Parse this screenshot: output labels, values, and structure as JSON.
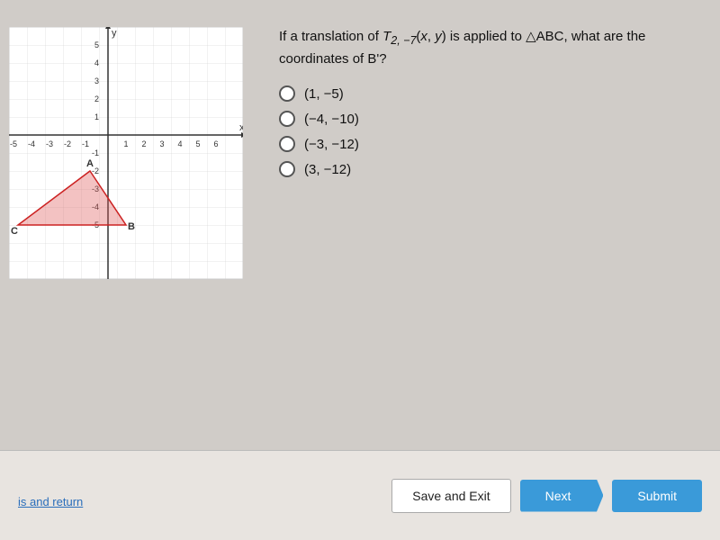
{
  "question": {
    "text_part1": "If a translation of ",
    "formula": "T",
    "subscript": "2, −7",
    "text_part2": "(x, y) is applied to △ABC, what are the coordinates of B'?",
    "options": [
      {
        "id": "opt1",
        "label": "(1, −5)"
      },
      {
        "id": "opt2",
        "label": "(−4, −10)"
      },
      {
        "id": "opt3",
        "label": "(−3, −12)"
      },
      {
        "id": "opt4",
        "label": "(3, −12)"
      }
    ]
  },
  "buttons": {
    "save_exit": "Save and Exit",
    "next": "Next",
    "submit": "Submit"
  },
  "bottom_link": "is and return",
  "graph": {
    "x_label": "x",
    "y_label": "y",
    "vertex_labels": [
      "A",
      "B",
      "C"
    ]
  }
}
